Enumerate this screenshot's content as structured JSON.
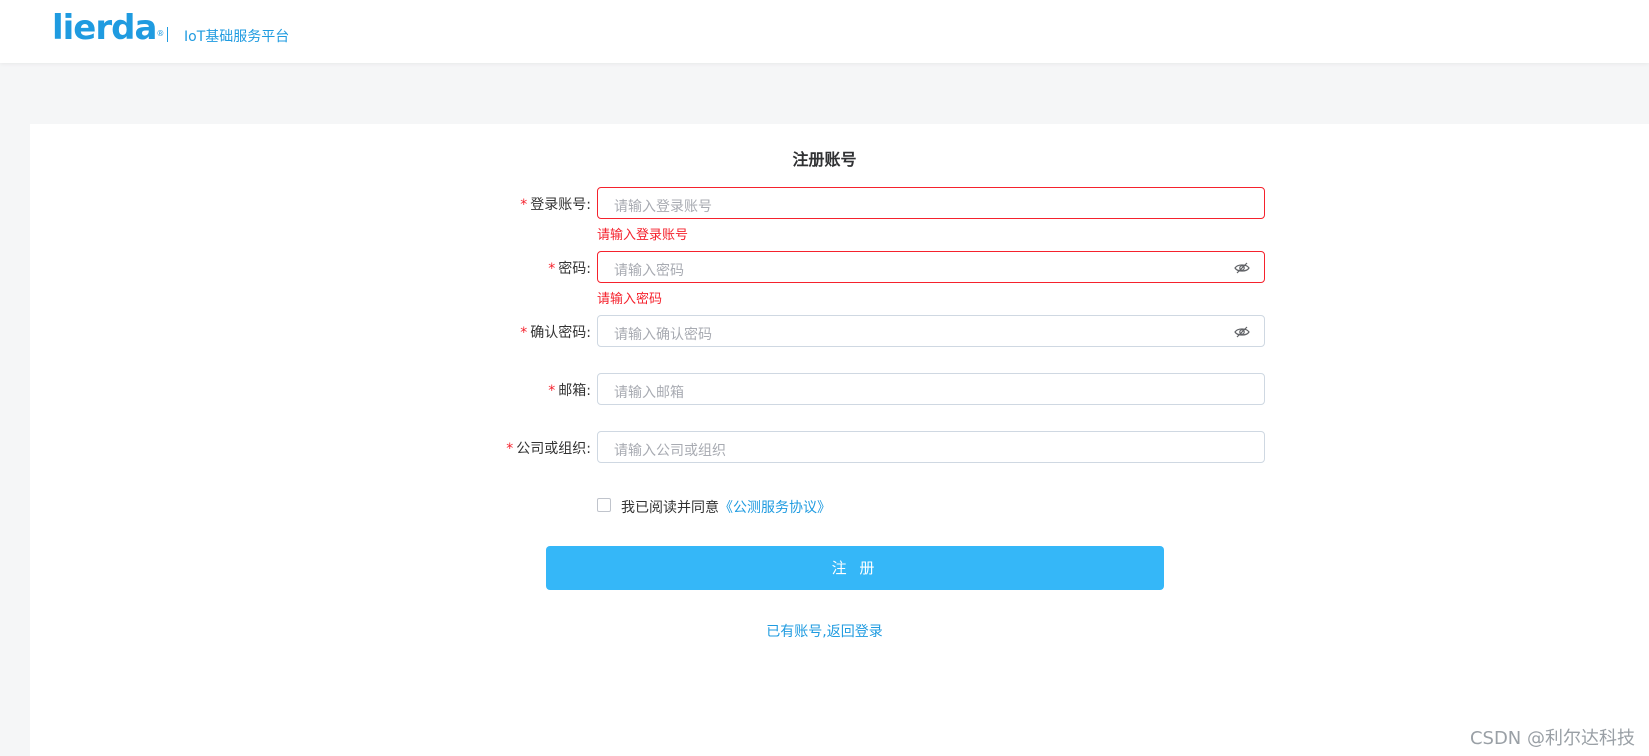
{
  "header": {
    "logo_text": "lierda",
    "logo_reg": "®",
    "platform_name": "IoT基础服务平台"
  },
  "form": {
    "title": "注册账号",
    "required_mark": "*",
    "fields": [
      {
        "label": "登录账号:",
        "placeholder": "请输入登录账号",
        "error": "请输入登录账号"
      },
      {
        "label": "密码:",
        "placeholder": "请输入密码",
        "error": "请输入密码"
      },
      {
        "label": "确认密码:",
        "placeholder": "请输入确认密码"
      },
      {
        "label": "邮箱:",
        "placeholder": "请输入邮箱"
      },
      {
        "label": "公司或组织:",
        "placeholder": "请输入公司或组织"
      }
    ],
    "agree_text": "我已阅读并同意",
    "agree_link": "《公测服务协议》",
    "submit_label": "注 册",
    "back_login": "已有账号,返回登录"
  },
  "watermark": "CSDN @利尔达科技",
  "colors": {
    "brand": "#1f9be0",
    "button": "#35b7f8",
    "error": "#f5222d"
  },
  "icons": [
    "eye-off-icon"
  ]
}
